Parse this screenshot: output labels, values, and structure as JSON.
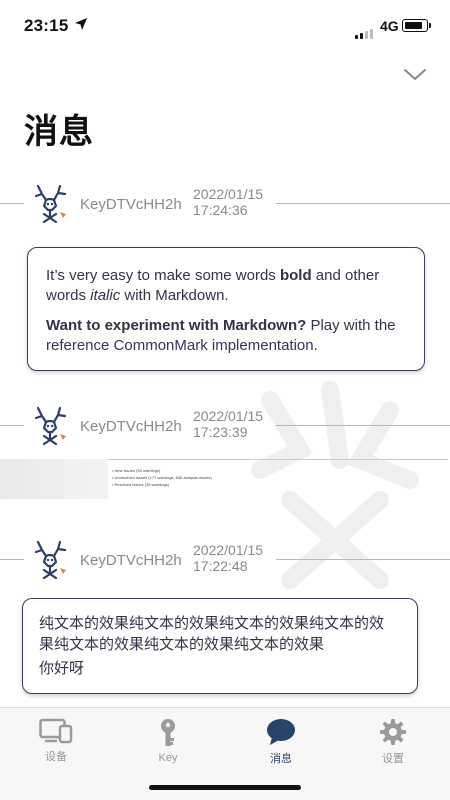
{
  "status_bar": {
    "time": "23:15",
    "network": "4G"
  },
  "page": {
    "title": "消息"
  },
  "messages": [
    {
      "sender": "KeyDTVcHH2h",
      "date": "2022/01/15",
      "time": "17:24:36",
      "type": "markdown",
      "p1_a": "It’s very easy to make some words ",
      "p1_bold": "bold",
      "p1_b": " and other words ",
      "p1_italic": "italic",
      "p1_c": " with Markdown.",
      "p2_bold": "Want to experiment with Markdown?",
      "p2_a": " Play with the ",
      "p2_link": "reference CommonMark implementation",
      "p2_b": "."
    },
    {
      "sender": "KeyDTVcHH2h",
      "date": "2022/01/15",
      "time": "17:23:39",
      "type": "image",
      "image_lines": [
        "• New issues (50 warnings)",
        "• Unresolved issues (177 warnings, 836 analysis issues)",
        "• Resolved issues (35 warnings)"
      ]
    },
    {
      "sender": "KeyDTVcHH2h",
      "date": "2022/01/15",
      "time": "17:22:48",
      "type": "text",
      "line1": "纯文本的效果纯文本的效果纯文本的效果纯文本的效",
      "line2": "果纯文本的效果纯文本的效果纯文本的效果",
      "line3": "你好呀"
    }
  ],
  "tabs": [
    {
      "label": "设备",
      "icon": "device-icon",
      "active": false
    },
    {
      "label": "Key",
      "icon": "key-icon",
      "active": false
    },
    {
      "label": "消息",
      "icon": "chat-bubble-icon",
      "active": true
    },
    {
      "label": "设置",
      "icon": "gear-icon",
      "active": false
    }
  ],
  "colors": {
    "active_tab": "#27446b",
    "inactive_tab": "#999999",
    "bubble_border": "#3d3d5c"
  }
}
